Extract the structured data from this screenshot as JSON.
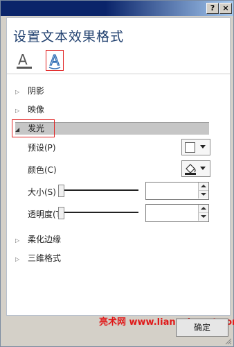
{
  "dialog": {
    "title": "设置文本效果格式",
    "title_buttons": {
      "help": "?",
      "close": "×"
    },
    "tabs": [
      {
        "name": "text-fill",
        "icon": "text-fill-outline-icon",
        "glyph": "A"
      },
      {
        "name": "text-effects",
        "icon": "text-effects-icon",
        "glyph": "A",
        "selected": true
      }
    ],
    "sections": [
      {
        "label": "阴影",
        "expanded": false
      },
      {
        "label": "映像",
        "expanded": false
      },
      {
        "label": "发光",
        "expanded": true
      },
      {
        "label": "柔化边缘",
        "expanded": false
      },
      {
        "label": "三维格式",
        "expanded": false
      }
    ],
    "glow": {
      "preset_label": "预设(P)",
      "color_label": "颜色(C)",
      "size_label": "大小(S)",
      "size_value": "",
      "transparency_label": "透明度(T)",
      "transparency_value": ""
    },
    "watermark": "亮术网 www.liangshunet.com",
    "ok_label": "确定"
  },
  "colors": {
    "titlebar_start": "#0a246a",
    "titlebar_end": "#a6caf0",
    "title_text": "#1f3f6e",
    "highlight_border": "#e02020"
  }
}
